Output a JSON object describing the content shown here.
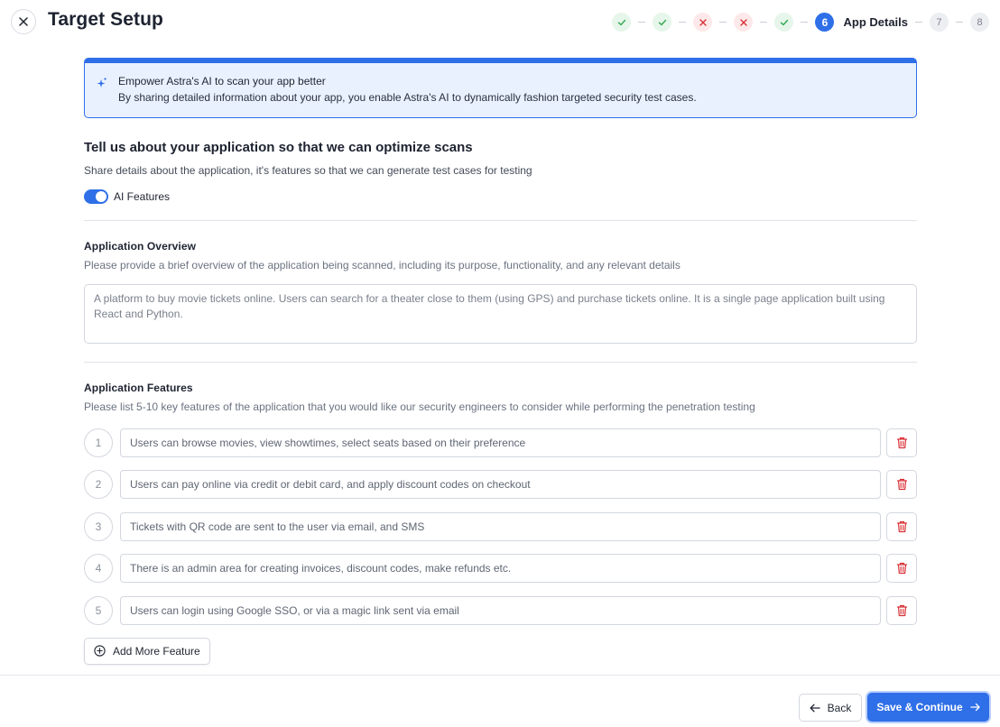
{
  "header": {
    "title": "Target Setup",
    "steps": [
      {
        "status": "done",
        "icon": "check-icon"
      },
      {
        "status": "done",
        "icon": "check-icon"
      },
      {
        "status": "error",
        "icon": "x-icon"
      },
      {
        "status": "error",
        "icon": "x-icon"
      },
      {
        "status": "done",
        "icon": "check-icon"
      },
      {
        "status": "active",
        "number": "6",
        "label": "App Details"
      },
      {
        "status": "todo",
        "number": "7"
      },
      {
        "status": "todo",
        "number": "8"
      }
    ]
  },
  "banner": {
    "title": "Empower Astra's AI to scan your app better",
    "text": "By sharing detailed information about your app, you enable Astra's AI to dynamically fashion targeted security test cases."
  },
  "intro": {
    "title": "Tell us about your application so that we can optimize scans",
    "description": "Share details about the application, it's features so that we can generate test cases for testing",
    "toggle_label": "AI Features",
    "toggle_on": true
  },
  "overview": {
    "title": "Application Overview",
    "description": "Please provide a brief overview of the application being scanned, including its purpose, functionality, and any relevant details",
    "value": "A platform to buy movie tickets online. Users can search for a theater close to them (using GPS) and purchase tickets online. It is a single page application built using React and Python."
  },
  "features": {
    "title": "Application Features",
    "description": "Please list 5-10 key features of the application that you would like our security engineers to consider while performing the penetration testing",
    "items": [
      {
        "num": "1",
        "value": "Users can browse movies, view showtimes, select seats based on their preference"
      },
      {
        "num": "2",
        "value": "Users can pay online via credit or debit card, and apply discount codes on checkout"
      },
      {
        "num": "3",
        "value": "Tickets with QR code are sent to the user via email, and SMS"
      },
      {
        "num": "4",
        "value": "There is an admin area for creating invoices, discount codes, make refunds etc."
      },
      {
        "num": "5",
        "value": "Users can login using Google SSO, or via a magic link sent via email"
      }
    ],
    "add_label": "Add More Feature"
  },
  "footer": {
    "back_label": "Back",
    "save_label": "Save & Continue"
  },
  "colors": {
    "accent": "#2f6fe8",
    "success": "#34a853",
    "error": "#d93036"
  }
}
